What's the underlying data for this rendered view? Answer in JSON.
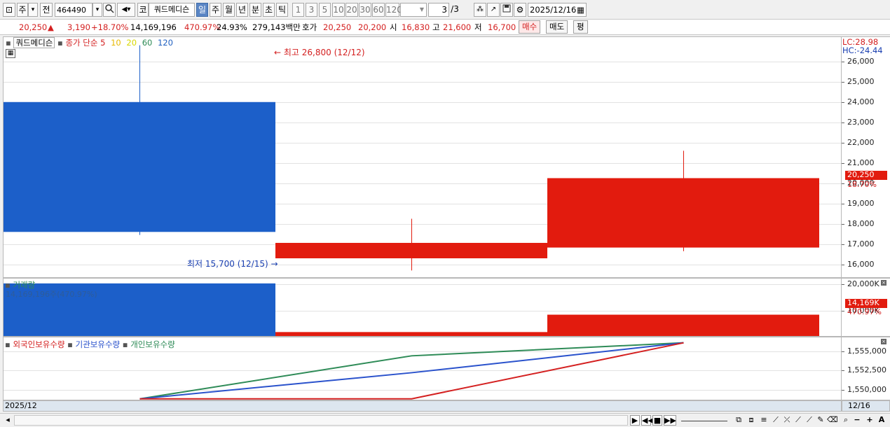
{
  "toolbar": {
    "market": "주",
    "market_arrow": "▾",
    "prev_label": "전",
    "code": "464490",
    "code_arrow": "▾",
    "search_icon": "search-icon",
    "sound_icon": "speaker-icon",
    "name_prefix": "코",
    "stock_name": "쿼드메디슨",
    "periods": [
      "일",
      "주",
      "월",
      "년",
      "분",
      "초",
      "틱"
    ],
    "active_period": "일",
    "intervals": [
      "1",
      "3",
      "5",
      "10",
      "20",
      "30",
      "60",
      "120"
    ],
    "page": "3",
    "page_total": "/3",
    "date": "2025/12/16"
  },
  "quote": {
    "price": "20,250",
    "up_arrow": "▲",
    "change": "3,190",
    "change_pct": "+18.70%",
    "volume": "14,169,196",
    "volume_ratio": "470.97%",
    "turnover": "24.93%",
    "amount": "279,143백만",
    "ask_label": "호가",
    "ask": "20,250",
    "bid": "20,200",
    "open_label": "시",
    "open": "16,830",
    "high_label": "고",
    "high": "21,600",
    "low_label": "저",
    "low": "16,700",
    "buy_label": "매수",
    "sell_label": "매도",
    "eval_label": "평"
  },
  "price_panel": {
    "name": "쿼드메디슨",
    "legend_prefix": "종가 단순",
    "ma": [
      {
        "label": "5",
        "color": "#d42020"
      },
      {
        "label": "10",
        "color": "#e8b800"
      },
      {
        "label": "20",
        "color": "#d8d800"
      },
      {
        "label": "60",
        "color": "#2e8b57"
      },
      {
        "label": "120",
        "color": "#2060c0"
      }
    ],
    "lc": "LC:28.98",
    "hc": "HC:-24.44",
    "max_label": "최고 26,800 (12/12)",
    "min_label": "최저 15,700 (12/15)",
    "y_ticks": [
      "26,000",
      "25,000",
      "24,000",
      "23,000",
      "22,000",
      "21,000",
      "20,000",
      "19,000",
      "18,000",
      "17,000",
      "16,000"
    ],
    "last_tag": "20,250",
    "last_pct": "18.70%"
  },
  "volume_panel": {
    "title": "거래량",
    "info": "14,169,196주(470.97%)",
    "y_ticks": [
      "20,000K",
      "10,000K"
    ],
    "last_tag": "14,169K",
    "last_pct": "470.97%"
  },
  "holdings_panel": {
    "series": [
      {
        "name": "외국인보유수량",
        "color": "#d42020"
      },
      {
        "name": "기관보유수량",
        "color": "#2a52cc"
      },
      {
        "name": "개인보유수량",
        "color": "#2e8b57"
      }
    ],
    "y_ticks": [
      "1,555,000",
      "1,552,500",
      "1,550,000"
    ]
  },
  "x_axis": {
    "start": "2025/12",
    "end": "12/16"
  },
  "chart_data": [
    {
      "type": "candlestick",
      "title": "쿼드메디슨",
      "x": [
        "12/12",
        "12/15",
        "12/16"
      ],
      "open": [
        24000,
        16300,
        16830
      ],
      "high": [
        26800,
        18250,
        21600
      ],
      "low": [
        17450,
        15700,
        16650
      ],
      "close": [
        17600,
        17060,
        20250
      ],
      "direction": [
        "down",
        "up",
        "up"
      ],
      "ylim": [
        15300,
        27200
      ]
    },
    {
      "type": "bar",
      "title": "거래량",
      "x": [
        "12/12",
        "12/15",
        "12/16"
      ],
      "values": [
        20200000,
        2000000,
        8500000
      ],
      "ylim": [
        0,
        22000000
      ]
    },
    {
      "type": "line",
      "x": [
        "12/12",
        "12/15",
        "12/16"
      ],
      "series": [
        {
          "name": "외국인보유수량",
          "values": [
            1548800,
            1548800,
            1556100
          ]
        },
        {
          "name": "기관보유수량",
          "values": [
            1548800,
            1552200,
            1556100
          ]
        },
        {
          "name": "개인보유수량",
          "values": [
            1548800,
            1554400,
            1556100
          ]
        }
      ],
      "ylim": [
        1548500,
        1556800
      ]
    }
  ]
}
